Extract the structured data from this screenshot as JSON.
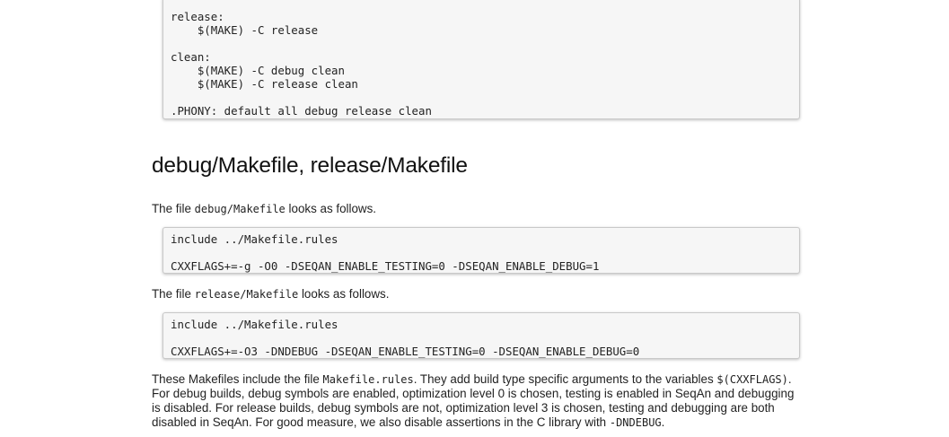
{
  "code_block_1": {
    "lines": [
      "release:",
      "    $(MAKE) -C release",
      "",
      "clean:",
      "    $(MAKE) -C debug clean",
      "    $(MAKE) -C release clean",
      "",
      ".PHONY: default all debug release clean"
    ]
  },
  "section": {
    "heading": "debug/Makefile, release/Makefile"
  },
  "para_debug": {
    "prefix": "The file ",
    "code": "debug/Makefile",
    "suffix": " looks as follows."
  },
  "code_block_2": {
    "lines": [
      "include ../Makefile.rules",
      "",
      "CXXFLAGS+=-g -O0 -DSEQAN_ENABLE_TESTING=0 -DSEQAN_ENABLE_DEBUG=1"
    ]
  },
  "para_release": {
    "prefix": "The file ",
    "code": "release/Makefile",
    "suffix": " looks as follows."
  },
  "code_block_3": {
    "lines": [
      "include ../Makefile.rules",
      "",
      "CXXFLAGS+=-O3 -DNDEBUG -DSEQAN_ENABLE_TESTING=0 -DSEQAN_ENABLE_DEBUG=0"
    ]
  },
  "para_explain": {
    "t1": "These Makefiles include the file ",
    "c1": "Makefile.rules",
    "t2": ". They add build type specific arguments to the variables ",
    "c2": "$(CXXFLAGS)",
    "t3": ". For debug builds, debug symbols are enabled, optimization level 0 is chosen, testing is enabled in SeqAn and debugging is disabled. For release builds, debug symbols are not, optimization level 3 is chosen, testing and debugging are both disabled in SeqAn. For good measure, we also disable assertions in the C library with ",
    "c3": "-DNDEBUG",
    "t4": "."
  }
}
